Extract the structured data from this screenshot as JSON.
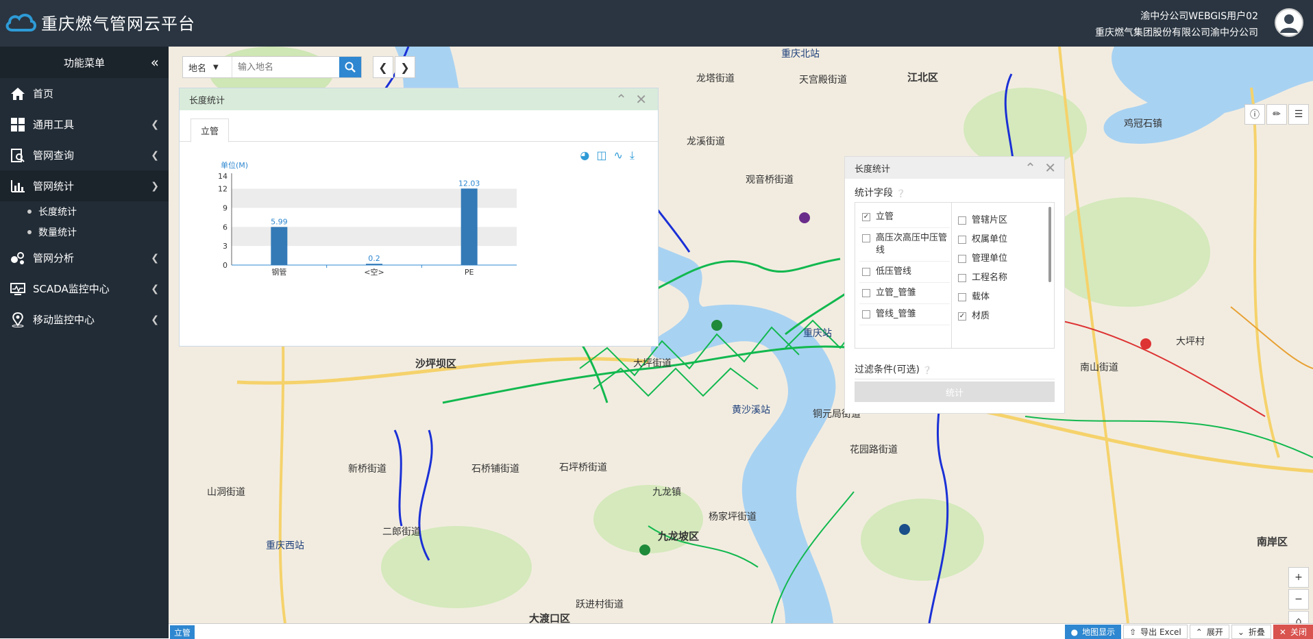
{
  "header": {
    "app_title": "重庆燃气管网云平台",
    "user_line1": "渝中分公司WEBGIS用户02",
    "user_line2": "重庆燃气集团股份有限公司渝中分公司"
  },
  "sidebar": {
    "title": "功能菜单",
    "collapse_icon": "«",
    "items": [
      {
        "label": "首页",
        "icon": "home-icon"
      },
      {
        "label": "通用工具",
        "icon": "grid-icon"
      },
      {
        "label": "管网查询",
        "icon": "query-icon"
      },
      {
        "label": "管网统计",
        "icon": "bar-chart-icon"
      },
      {
        "label": "管网分析",
        "icon": "analysis-icon"
      },
      {
        "label": "SCADA监控中心",
        "icon": "monitor-icon"
      },
      {
        "label": "移动监控中心",
        "icon": "location-icon"
      }
    ],
    "sub_items": [
      {
        "label": "长度统计"
      },
      {
        "label": "数量统计"
      }
    ]
  },
  "search": {
    "type_label": "地名",
    "placeholder": "输入地名"
  },
  "panel_length": {
    "title": "长度统计",
    "tab": "立管"
  },
  "chart_data": {
    "type": "bar",
    "ylabel": "单位(M)",
    "categories": [
      "钢管",
      "<空>",
      "PE"
    ],
    "values": [
      5.99,
      0.2,
      12.03
    ],
    "ylim": [
      0,
      14
    ],
    "yticks": [
      0,
      3,
      6,
      9,
      12,
      14
    ],
    "color": "#337ab7"
  },
  "panel_fields": {
    "title": "长度统计",
    "field_section": "统计字段",
    "filter_section": "过滤条件(可选)",
    "button": "统计",
    "left_fields": [
      {
        "label": "立管",
        "checked": true
      },
      {
        "label": "高压次高压中压管线",
        "checked": false
      },
      {
        "label": "低压管线",
        "checked": false
      },
      {
        "label": "立管_管雏",
        "checked": false
      },
      {
        "label": "管线_管雏",
        "checked": false
      }
    ],
    "right_fields": [
      {
        "label": "管辖片区",
        "checked": false
      },
      {
        "label": "权属单位",
        "checked": false
      },
      {
        "label": "管理单位",
        "checked": false
      },
      {
        "label": "工程名称",
        "checked": false
      },
      {
        "label": "载体",
        "checked": false
      },
      {
        "label": "材质",
        "checked": true
      }
    ]
  },
  "map_labels": [
    {
      "text": "重庆北站"
    },
    {
      "text": "龙塔街道"
    },
    {
      "text": "天宫殿街道"
    },
    {
      "text": "江北区"
    },
    {
      "text": "龙溪街道"
    },
    {
      "text": "观音桥街道"
    },
    {
      "text": "鸡冠石镇"
    },
    {
      "text": "沙坪坝区"
    },
    {
      "text": "大坪街道"
    },
    {
      "text": "黄沙溪站"
    },
    {
      "text": "铜元局街道"
    },
    {
      "text": "南山街道"
    },
    {
      "text": "大坪村"
    },
    {
      "text": "花园路街道"
    },
    {
      "text": "新桥街道"
    },
    {
      "text": "石桥铺街道"
    },
    {
      "text": "石坪桥街道"
    },
    {
      "text": "九龙镇"
    },
    {
      "text": "山洞街道"
    },
    {
      "text": "杨家坪街道"
    },
    {
      "text": "二郎街道"
    },
    {
      "text": "九龙坡区"
    },
    {
      "text": "重庆西站"
    },
    {
      "text": "跃进村街道"
    },
    {
      "text": "大渡口区"
    },
    {
      "text": "南岸区"
    },
    {
      "text": "重庆站"
    }
  ],
  "bottom": {
    "tab": "立管",
    "buttons": [
      {
        "label": "地图显示"
      },
      {
        "label": "导出 Excel"
      },
      {
        "label": "展开"
      },
      {
        "label": "折叠"
      },
      {
        "label": "关闭"
      }
    ]
  }
}
